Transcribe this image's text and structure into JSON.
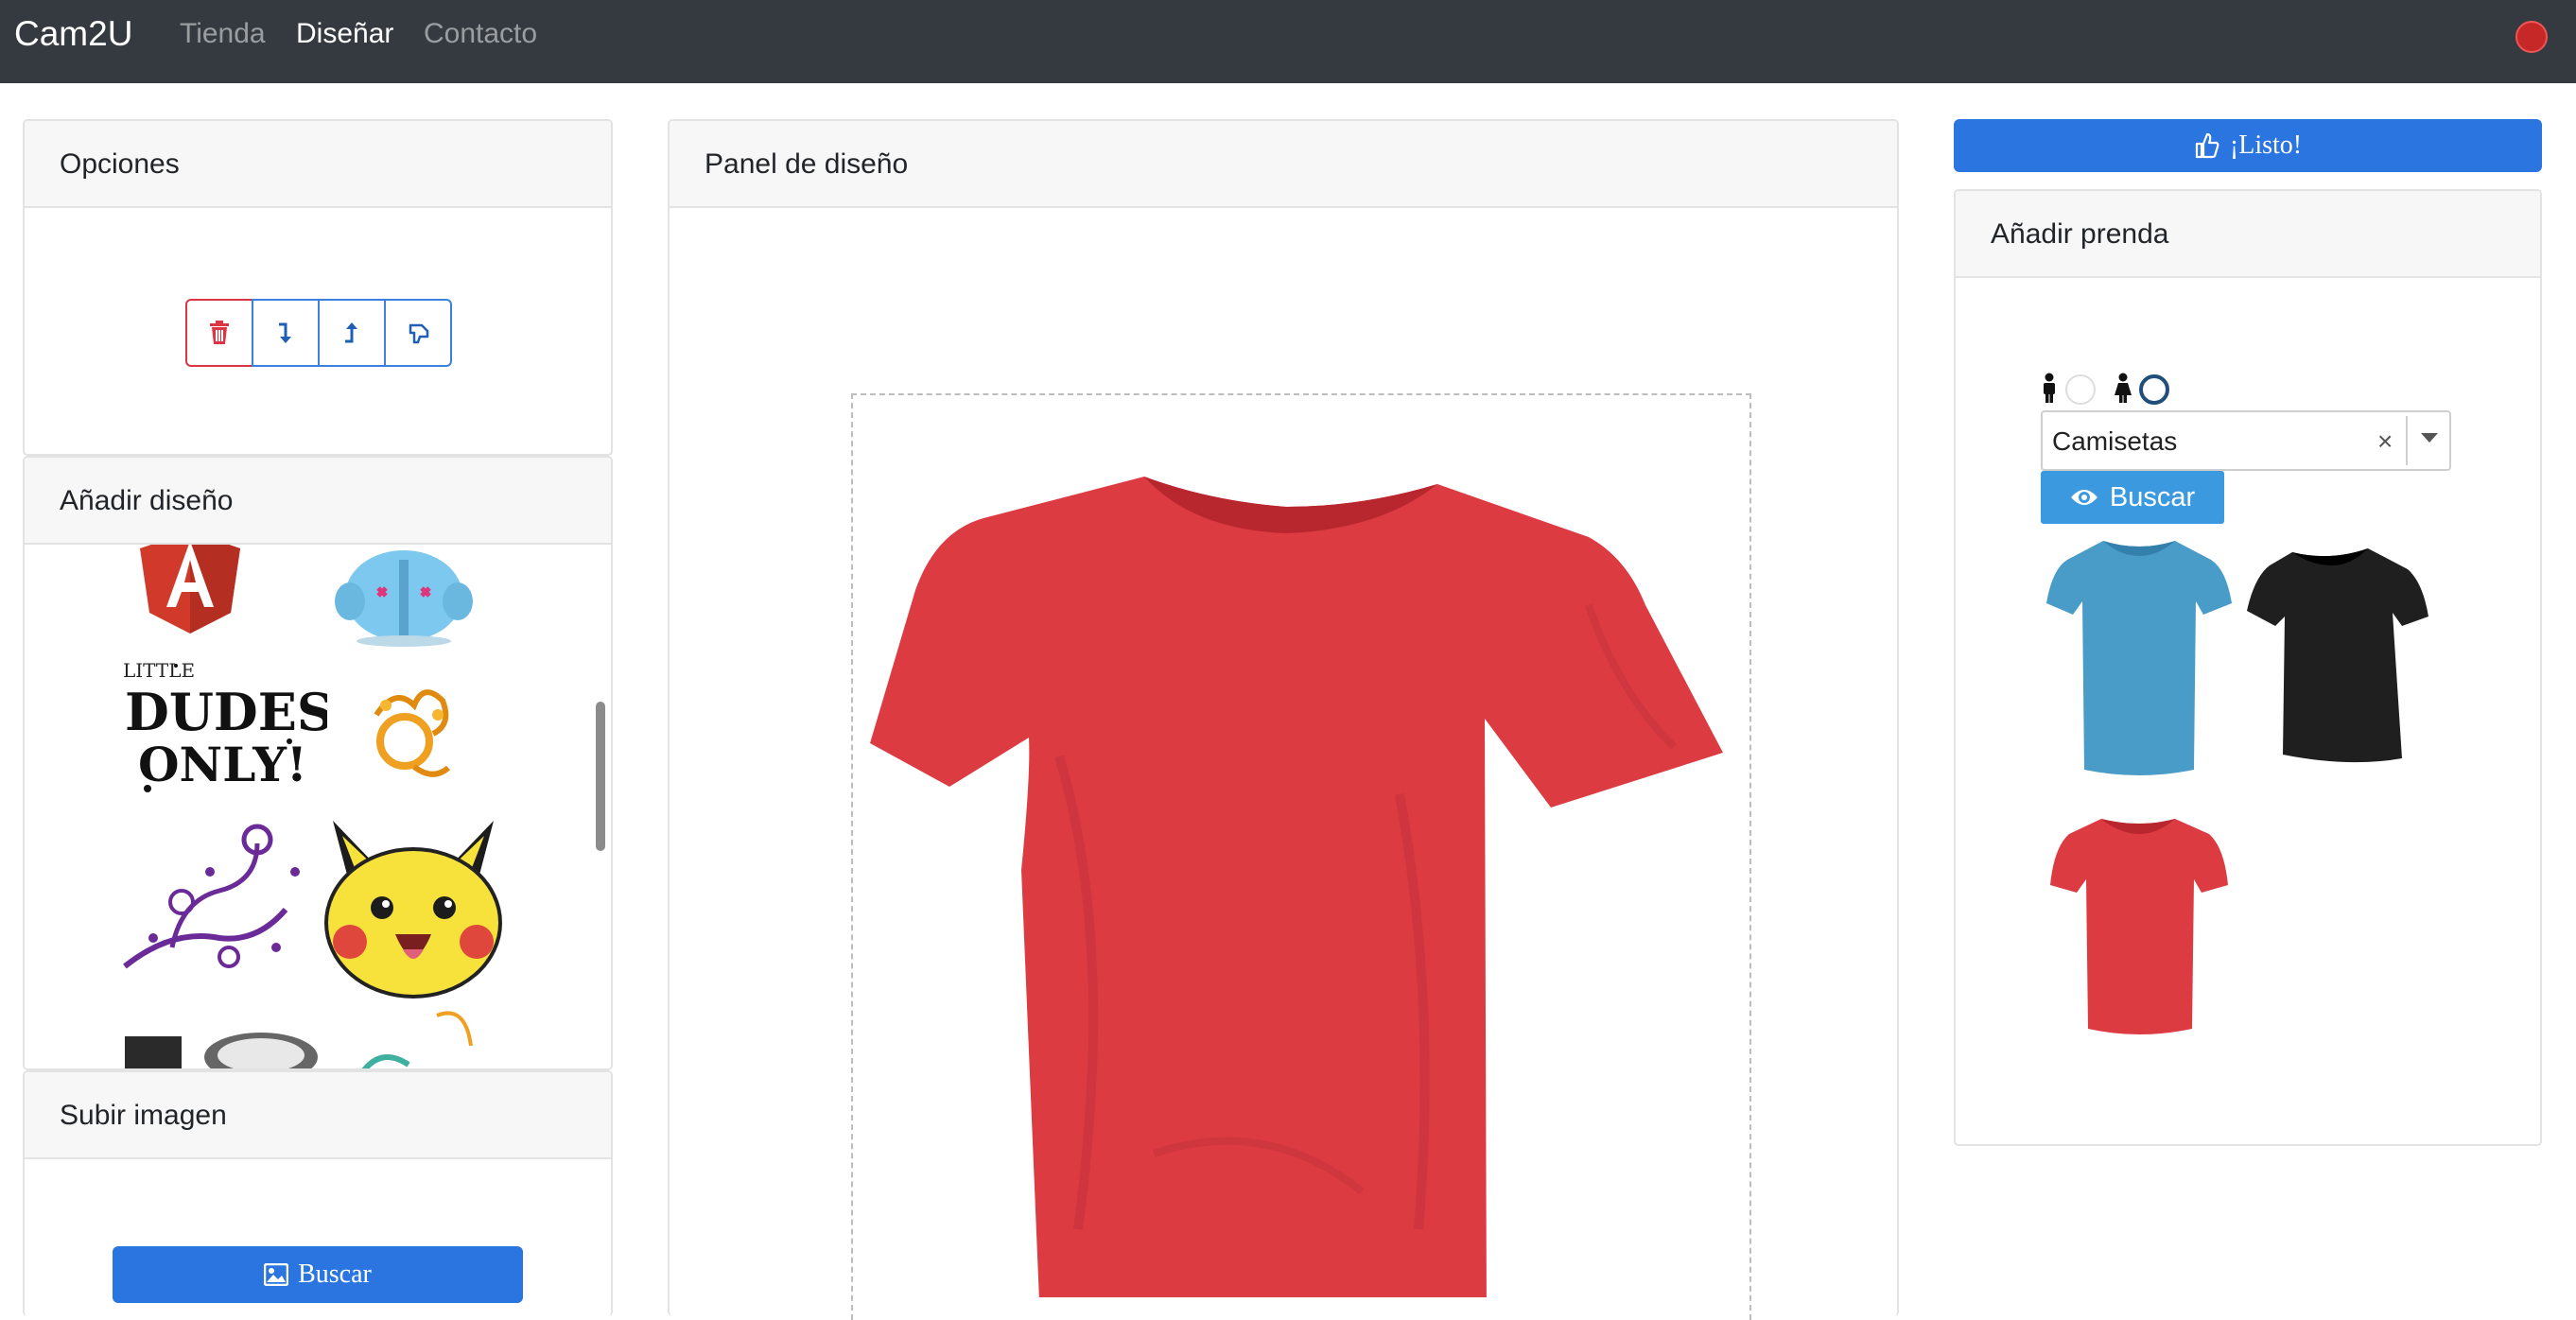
{
  "nav": {
    "brand": "Cam2U",
    "links": [
      {
        "label": "Tienda",
        "active": false
      },
      {
        "label": "Diseñar",
        "active": true
      },
      {
        "label": "Contacto",
        "active": false
      }
    ]
  },
  "options": {
    "title": "Opciones",
    "buttons": [
      "trash-icon",
      "send-backward-icon",
      "bring-forward-icon",
      "flip-icon"
    ]
  },
  "add_design": {
    "title": "Añadir diseño",
    "designs": [
      "angular-logo",
      "blue-bear",
      "little-dudes-only",
      "floral-circle-orange",
      "purple-floral",
      "pikachu",
      "partial-design-1",
      "partial-design-2"
    ]
  },
  "upload": {
    "title": "Subir imagen",
    "button_label": "Buscar"
  },
  "design_panel": {
    "title": "Panel de diseño",
    "garment_color": "#dc3b42"
  },
  "listo_label": "¡Listo!",
  "add_garment": {
    "title": "Añadir prenda",
    "gender_options": [
      "male-icon",
      "female-icon"
    ],
    "selected_gender": "female",
    "category": "Camisetas",
    "search_label": "Buscar",
    "garments": [
      {
        "color": "#4a9cc8"
      },
      {
        "color": "#1f1f1f"
      },
      {
        "color": "#dc3b42"
      }
    ]
  },
  "colors": {
    "navbar": "#343a40",
    "primary": "#2a75e0",
    "info": "#3b99e0",
    "danger": "#dc3545"
  }
}
